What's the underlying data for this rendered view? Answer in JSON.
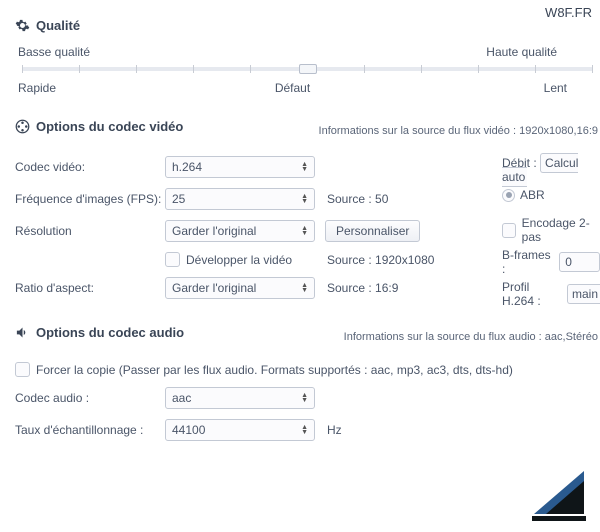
{
  "watermark": "W8F.FR",
  "quality": {
    "title": "Qualité",
    "low": "Basse qualité",
    "high": "Haute qualité",
    "fast": "Rapide",
    "default": "Défaut",
    "slow": "Lent"
  },
  "videoCodec": {
    "title": "Options du codec vidéo",
    "info": "Informations sur la source du flux vidéo : 1920x1080,16:9",
    "codecLabel": "Codec vidéo:",
    "codecValue": "h.264",
    "fpsLabel": "Fréquence d'images (FPS):",
    "fpsValue": "25",
    "fpsSource": "Source : 50",
    "resolutionLabel": "Résolution",
    "resolutionValue": "Garder l'original",
    "customizeBtn": "Personnaliser",
    "developVideo": "Développer la vidéo",
    "resolutionSource": "Source : 1920x1080",
    "aspectLabel": "Ratio d'aspect:",
    "aspectValue": "Garder l'original",
    "aspectSource": "Source : 16:9",
    "rateLabel": "Débit :",
    "rateValue": "Calcul auto",
    "abr": "ABR",
    "twopass": "Encodage 2-pas",
    "bframesLabel": "B-frames :",
    "bframesValue": "0",
    "profileLabel": "Profil H.264 :",
    "profileValue": "main"
  },
  "audioCodec": {
    "title": "Options du codec audio",
    "info": "Informations sur la source du flux audio : aac,Stéréo",
    "forceCopy": "Forcer la copie (Passer par les flux audio. Formats supportés : aac, mp3, ac3, dts, dts-hd)",
    "codecLabel": "Codec audio :",
    "codecValue": "aac",
    "sampleLabel": "Taux d'échantillonnage :",
    "sampleValue": "44100",
    "sampleUnit": "Hz"
  }
}
